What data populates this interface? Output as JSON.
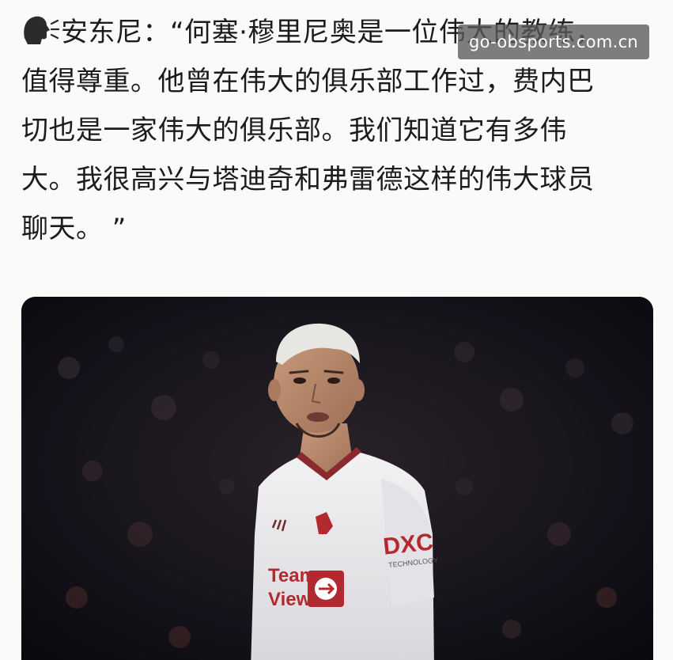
{
  "post": {
    "lines": [
      "安东尼：“何塞·穆里尼奥是一位伟大的教练，",
      "值得尊重。他曾在伟大的俱乐部工作过，费内巴",
      "切也是一家伟大的俱乐部。我们知道它有多伟",
      "大。我很高兴与塔迪奇和弗雷德这样的伟大球员",
      "聊天。 ”"
    ],
    "icon": "speaking-head-icon"
  },
  "watermark": {
    "text": "go-obsports.com.cn"
  },
  "photo": {
    "jersey_badge": "man-utd-crest",
    "sponsor_sleeve": "DXC",
    "sponsor_sleeve_sub": "TECHNOLOGY",
    "sponsor_front_line1": "Team",
    "sponsor_front_line2": "Viewer"
  }
}
